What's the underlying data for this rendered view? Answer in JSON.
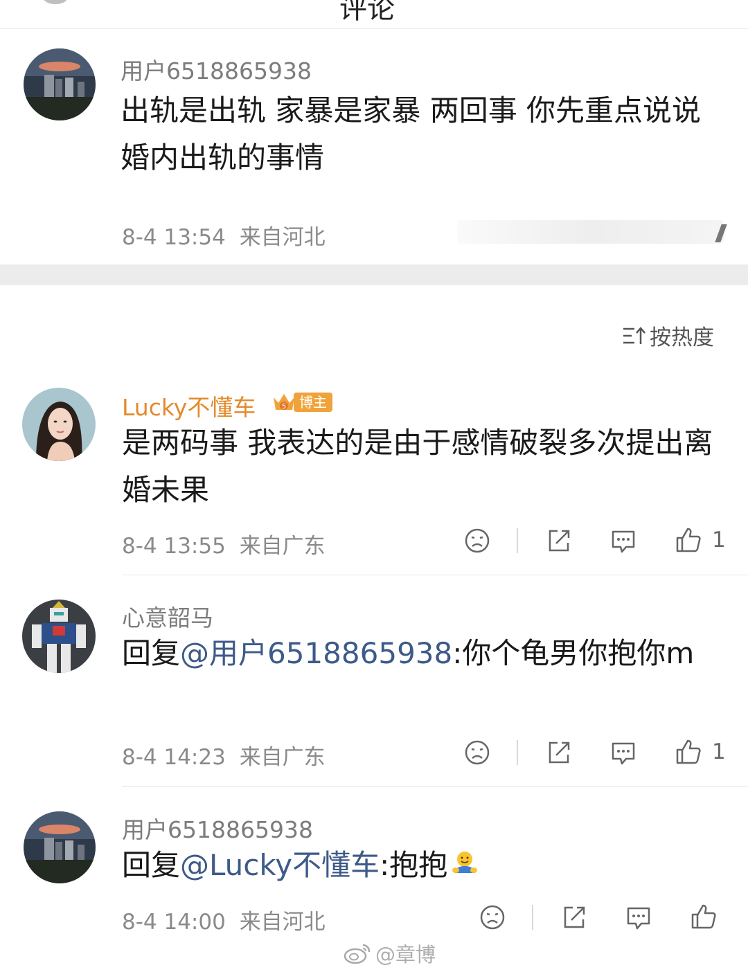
{
  "header": {
    "title_fragment": "评论"
  },
  "main_post": {
    "username": "用户6518865938",
    "content": "出轨是出轨 家暴是家暴 两回事 你先重点说说婚内出轨的事情",
    "time": "8-4 13:54",
    "location": "来自河北"
  },
  "sort": {
    "label": "按热度",
    "icon": "sort-hot-icon"
  },
  "comments": [
    {
      "username": "Lucky不懂车",
      "badge": "博主",
      "content": "是两码事 我表达的是由于感情破裂多次提出离婚未果",
      "time": "8-4 13:55",
      "location": "来自广东",
      "like_count": "1"
    },
    {
      "username": "心意韶马",
      "reply_prefix": "回复",
      "mention": "@用户6518865938",
      "content": ":你个龟男你抱你m",
      "time": "8-4 14:23",
      "location": "来自广东",
      "like_count": "1"
    },
    {
      "username": "用户6518865938",
      "reply_prefix": "回复",
      "mention": "@Lucky不懂车",
      "content": ":抱抱",
      "emoji": "hug-emoji",
      "time": "8-4 14:00",
      "location": "来自河北",
      "like_count": ""
    }
  ],
  "watermark": {
    "text": "@章博",
    "icon": "weibo-icon"
  },
  "colors": {
    "gold_name": "#e48a2b",
    "mention": "#3d5a88",
    "meta": "#8a8a8a",
    "divider": "#ececec"
  }
}
